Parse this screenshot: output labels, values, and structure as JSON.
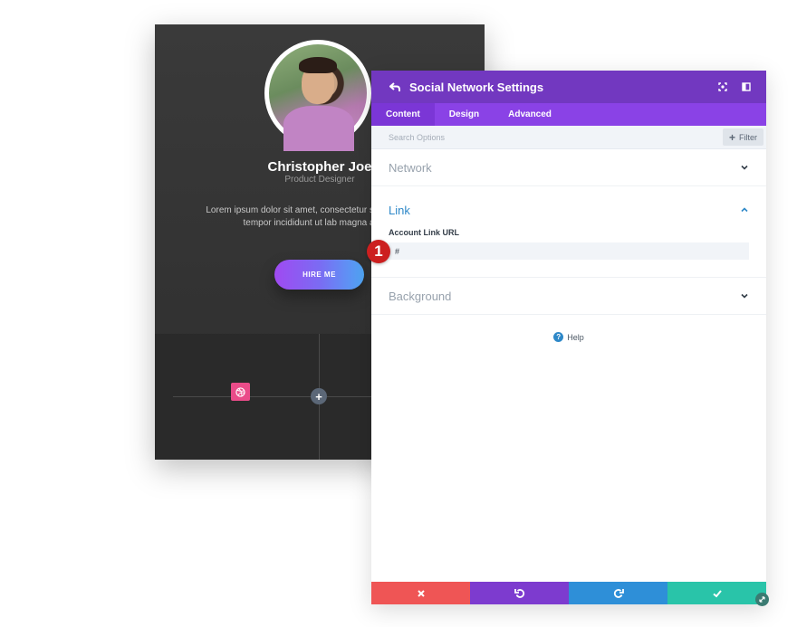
{
  "profile_card": {
    "name": "Christopher Joe",
    "role": "Product Designer",
    "bio": "Lorem ipsum dolor sit amet, consectetur sed do eiusmod tempor incididunt ut lab magna aliqua.",
    "hire_button": "HIRE ME",
    "accent_gradient": [
      "#a04af1",
      "#4fa7f5"
    ],
    "social_icon": "dribbble-icon",
    "social_color": "#ea4c89"
  },
  "panel": {
    "title": "Social Network Settings",
    "header_color": "#7238c0",
    "tabs": [
      {
        "label": "Content",
        "active": true
      },
      {
        "label": "Design",
        "active": false
      },
      {
        "label": "Advanced",
        "active": false
      }
    ],
    "search_placeholder": "Search Options",
    "filter_label": "Filter",
    "sections": {
      "network": {
        "title": "Network",
        "expanded": false
      },
      "link": {
        "title": "Link",
        "expanded": true,
        "field_label": "Account Link URL",
        "field_value": "#"
      },
      "background": {
        "title": "Background",
        "expanded": false
      }
    },
    "help_label": "Help",
    "footer_colors": {
      "cancel": "#ef5555",
      "undo": "#7d3bcf",
      "redo": "#2e8fd8",
      "save": "#29c4a9"
    }
  },
  "annotation": {
    "step_number": "1",
    "color": "#cc1f1f"
  }
}
